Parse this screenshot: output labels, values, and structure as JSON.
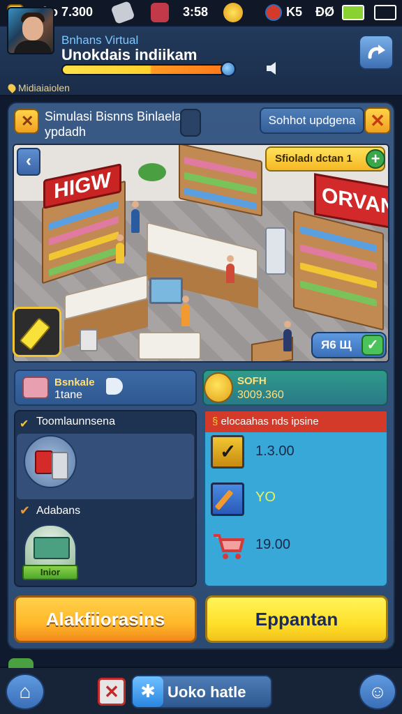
{
  "status_bar": {
    "left_label": "Fnko 7.300",
    "time": "3:58",
    "signal_label": "K5",
    "battery_label": "ÐØ"
  },
  "header": {
    "subtitle": "Bnhans Virtual",
    "title": "Unokdais indiikam",
    "location": "Midiaiaiolen",
    "xp_fill_fraction": 0.97
  },
  "panel": {
    "title": "Simulasi Bisnns Binlaela ypdadh",
    "update_label": "Sohhot updgena",
    "close_glyph": "✕"
  },
  "scene": {
    "back_glyph": "‹",
    "sign_left": "HIGW",
    "sign_right": "ORVAN",
    "pill_label": "Sfioladı dctan  1",
    "pill_plus": "+",
    "confirm_label": "Я6 Щ",
    "confirm_check": "✓"
  },
  "stats": {
    "left_label": "Bsnkale",
    "left_value": "1tane",
    "right_label": "SOFH",
    "right_value": "3009.360"
  },
  "list": {
    "head_1": "Toomlaunnsena",
    "head_2": "Adabans",
    "item_2_tag": "Inior"
  },
  "info": {
    "header": "elocaahas nds ipsine",
    "rows": [
      {
        "icon": "checkbox-icon",
        "value": "1.3.00"
      },
      {
        "icon": "pencil-icon",
        "value": "YO"
      },
      {
        "icon": "cart-icon",
        "value": "19.00"
      }
    ]
  },
  "actions": {
    "left_label": "Alakfiiorasins",
    "right_label": "Eppantan"
  },
  "bottom_nav": {
    "home_glyph": "⌂",
    "red_glyph": "✕",
    "pill_glyph": "✱",
    "pill_label": "Uoko hatle",
    "profile_glyph": "☺"
  },
  "colors": {
    "accent_yellow": "#ffd04a",
    "panel_blue": "#3a5a86",
    "info_cyan": "#38a8d8",
    "alert_red": "#d43a2a"
  }
}
